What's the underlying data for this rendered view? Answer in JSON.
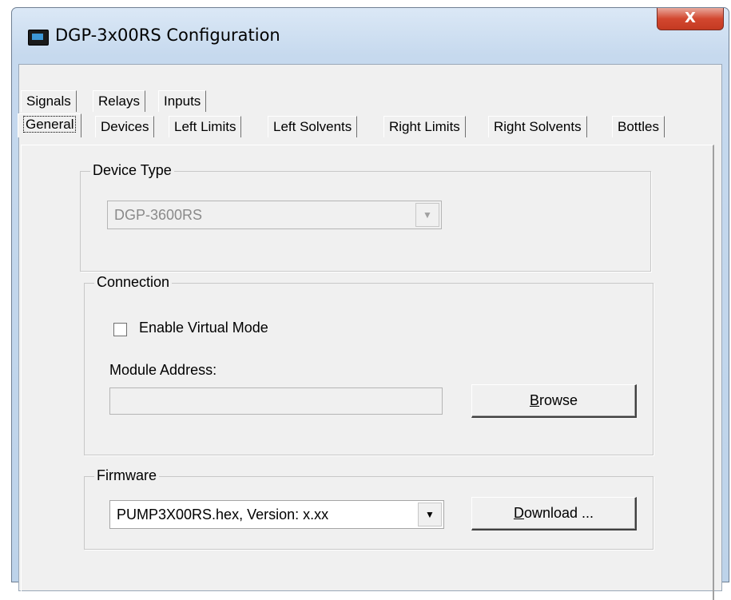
{
  "window": {
    "title": "DGP-3x00RS Configuration",
    "close_glyph": "X",
    "icon": "app-icon"
  },
  "tabs_row1": [
    "Signals",
    "Relays",
    "Inputs"
  ],
  "tabs_row2": [
    "General",
    "Devices",
    "Left Limits",
    "Left Solvents",
    "Right Limits",
    "Right Solvents",
    "Bottles"
  ],
  "selected_tab": "General",
  "device_type": {
    "legend": "Device Type",
    "value": "DGP-3600RS",
    "enabled": false
  },
  "connection": {
    "legend": "Connection",
    "virtual_mode_label": "Enable Virtual Mode",
    "virtual_mode_checked": false,
    "module_address_label": "Module Address:",
    "module_address_value": "",
    "browse_mnemonic": "B",
    "browse_rest": "rowse"
  },
  "firmware": {
    "legend": "Firmware",
    "value": "PUMP3X00RS.hex, Version: x.xx",
    "download_mnemonic": "D",
    "download_rest": "ownload ..."
  }
}
